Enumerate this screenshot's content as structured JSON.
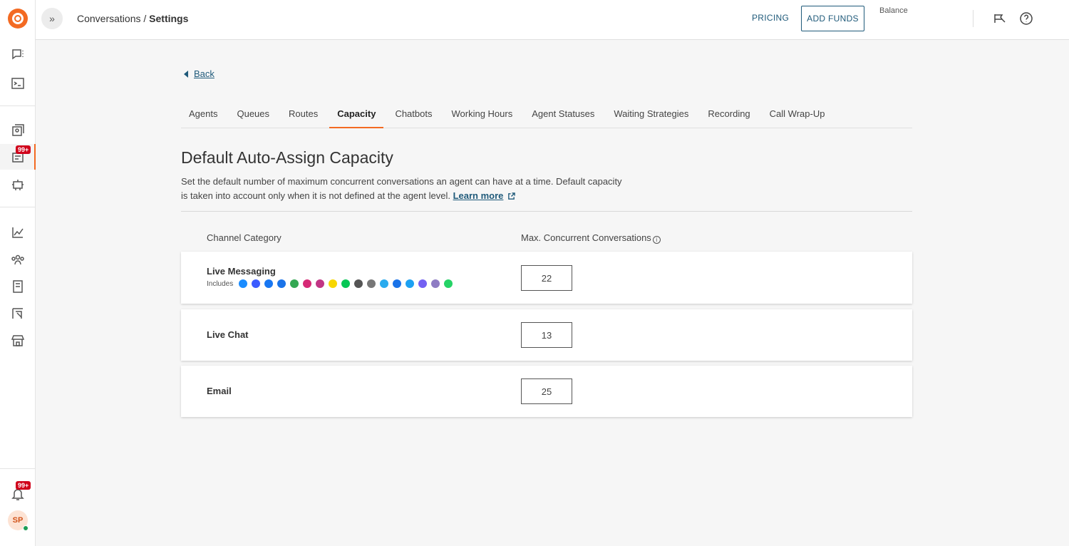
{
  "topbar": {
    "breadcrumb_prefix": "Conversations /",
    "breadcrumb_current": "Settings",
    "pricing_label": "PRICING",
    "add_funds_label": "ADD FUNDS",
    "balance_label": "Balance"
  },
  "sidebar": {
    "badge_conversations": "99+",
    "badge_notifications": "99+",
    "avatar_initials": "SP"
  },
  "back_label": "Back",
  "tabs": [
    {
      "label": "Agents"
    },
    {
      "label": "Queues"
    },
    {
      "label": "Routes"
    },
    {
      "label": "Capacity",
      "active": true
    },
    {
      "label": "Chatbots"
    },
    {
      "label": "Working Hours"
    },
    {
      "label": "Agent Statuses"
    },
    {
      "label": "Waiting Strategies"
    },
    {
      "label": "Recording"
    },
    {
      "label": "Call Wrap-Up"
    }
  ],
  "section": {
    "title": "Default Auto-Assign Capacity",
    "description": "Set the default number of maximum concurrent conversations an agent can have at a time. Default capacity is taken into account only when it is not defined at the agent level.",
    "learn_more": "Learn more"
  },
  "table": {
    "col_category": "Channel Category",
    "col_max": "Max. Concurrent Conversations",
    "includes_label": "Includes",
    "rows": [
      {
        "label": "Live Messaging",
        "value": "22"
      },
      {
        "label": "Live Chat",
        "value": "13"
      },
      {
        "label": "Email",
        "value": "25"
      }
    ]
  },
  "channel_icons": [
    {
      "name": "apple-messages-icon",
      "color": "#1a8cff"
    },
    {
      "name": "messenger-icon",
      "color": "#3b5bff"
    },
    {
      "name": "facebook-icon",
      "color": "#1877f2"
    },
    {
      "name": "google-business-icon",
      "color": "#1a73e8"
    },
    {
      "name": "google-play-icon",
      "color": "#34a853"
    },
    {
      "name": "instagram-icon",
      "color": "#d62976"
    },
    {
      "name": "instagram-alt-icon",
      "color": "#c13584"
    },
    {
      "name": "kakaotalk-icon",
      "color": "#f7d600"
    },
    {
      "name": "line-icon",
      "color": "#06c755"
    },
    {
      "name": "rcs-icon",
      "color": "#555555"
    },
    {
      "name": "sms-icon",
      "color": "#777777"
    },
    {
      "name": "telegram-icon",
      "color": "#2aabee"
    },
    {
      "name": "email-icon",
      "color": "#1a73e8"
    },
    {
      "name": "twitter-icon",
      "color": "#1da1f2"
    },
    {
      "name": "viber-icon",
      "color": "#7360f2"
    },
    {
      "name": "bot-icon",
      "color": "#8e7cc3"
    },
    {
      "name": "whatsapp-icon",
      "color": "#25d366"
    }
  ],
  "colors": {
    "accent": "#f36a22",
    "link": "#1f5a7a",
    "badge": "#d0021b"
  }
}
